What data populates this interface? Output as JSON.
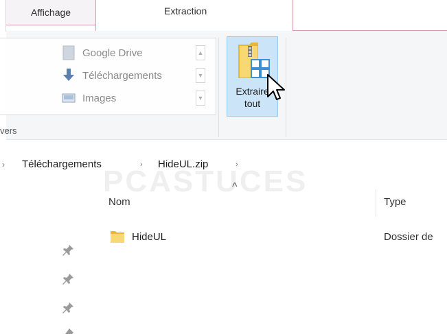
{
  "tabs": {
    "affichage": "Affichage",
    "extraction": "Extraction"
  },
  "ribbon": {
    "gallery_items": [
      {
        "label": "Google Drive",
        "icon": "google-drive-icon"
      },
      {
        "label": "Téléchargements",
        "icon": "download-arrow-icon"
      },
      {
        "label": "Images",
        "icon": "images-folder-icon"
      }
    ],
    "group_label": "vers",
    "extract_all": {
      "line1": "Extraire",
      "line2": "tout",
      "icon": "zip-folder-icon"
    }
  },
  "address_bar": {
    "crumbs": [
      "Téléchargements",
      "HideUL.zip"
    ]
  },
  "list": {
    "columns": {
      "name": "Nom",
      "type": "Type"
    },
    "rows": [
      {
        "name": "HideUL",
        "type": "Dossier de"
      }
    ]
  },
  "watermark": "PCASTUCES",
  "colors": {
    "tab_accent": "#d89aa8",
    "button_highlight": "#cce4f7",
    "button_border": "#99c8ee",
    "folder_yellow": "#f8d775"
  }
}
